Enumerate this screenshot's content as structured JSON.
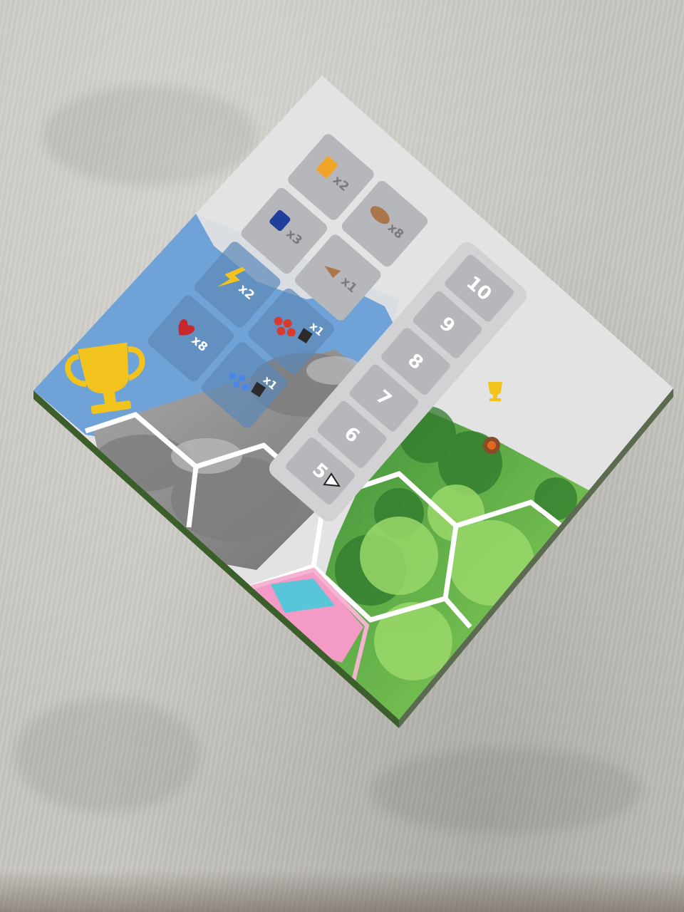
{
  "board": {
    "score_track": [
      "10",
      "9",
      "8",
      "7",
      "6",
      "5"
    ],
    "reward_slots": [
      {
        "icon": "ticket-icon",
        "count": "x2"
      },
      {
        "icon": "bag-icon",
        "count": "x3"
      },
      {
        "icon": "bread-icon",
        "count": "x8"
      },
      {
        "icon": "claw-icon",
        "count": "x1"
      },
      {
        "icon": "lightning-icon",
        "count": "x2"
      },
      {
        "icon": "heart-icon",
        "count": "x8"
      },
      {
        "icon": "animal-icon",
        "count": "x1"
      },
      {
        "icon": "animal-icon",
        "count": "x1"
      }
    ],
    "colors": {
      "sky": "#6fa3d8",
      "panel": "#e3e3e4",
      "slot": "#b6b7ba",
      "trophy": "#f2c31c",
      "forest": "#6cc23e",
      "rock": "#8e8e8e"
    }
  }
}
